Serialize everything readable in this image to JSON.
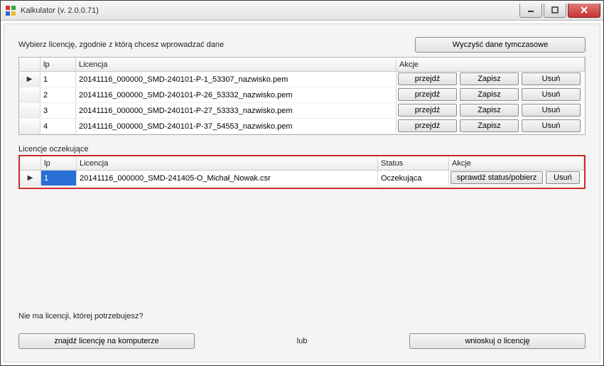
{
  "window": {
    "title": "Kalkulator (v. 2.0.0.71)"
  },
  "labels": {
    "instruction": "Wybierz licencję, zgodnie z którą chcesz wprowadzać dane",
    "clear_temp": "Wyczyść dane tymczasowe",
    "pending_section": "Licencje oczekujące",
    "no_license": "Nie ma licencji, której potrzebujesz?",
    "find_on_computer": "znajdź licencję na komputerze",
    "or": "lub",
    "apply": "wnioskuj o licencję"
  },
  "grid1": {
    "headers": {
      "lp": "lp",
      "lic": "Licencja",
      "actions": "Akcje"
    },
    "action_labels": {
      "go": "przejdź",
      "save": "Zapisz",
      "delete": "Usuń"
    },
    "rows": [
      {
        "lp": "1",
        "lic": "20141116_000000_SMD-240101-P-1_53307_nazwisko.pem"
      },
      {
        "lp": "2",
        "lic": "20141116_000000_SMD-240101-P-26_53332_nazwisko.pem"
      },
      {
        "lp": "3",
        "lic": "20141116_000000_SMD-240101-P-27_53333_nazwisko.pem"
      },
      {
        "lp": "4",
        "lic": "20141116_000000_SMD-240101-P-37_54553_nazwisko.pem"
      }
    ]
  },
  "grid2": {
    "headers": {
      "lp": "lp",
      "lic": "Licencja",
      "status": "Status",
      "actions": "Akcje"
    },
    "action_labels": {
      "check": "sprawdź status/pobierz",
      "delete": "Usuń"
    },
    "rows": [
      {
        "lp": "1",
        "lic": "20141116_000000_SMD-241405-O_Michał_Nowak.csr",
        "status": "Oczekująca"
      }
    ]
  }
}
